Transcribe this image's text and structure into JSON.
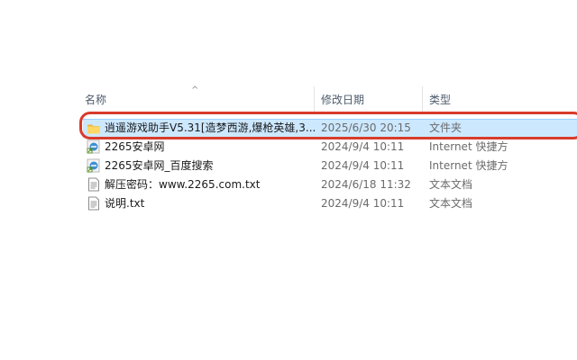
{
  "columns": {
    "name": "名称",
    "date": "修改日期",
    "type": "类型"
  },
  "sort_indicator": "^",
  "files": [
    {
      "icon": "folder-icon",
      "name": "逍遥游戏助手V5.31[造梦西游,爆枪英雄,3...",
      "date": "2025/6/30 20:15",
      "type": "文件夹",
      "selected": true
    },
    {
      "icon": "internet-shortcut-icon",
      "name": "2265安卓网",
      "date": "2024/9/4 10:11",
      "type": "Internet 快捷方",
      "selected": false
    },
    {
      "icon": "internet-shortcut-icon",
      "name": "2265安卓网_百度搜索",
      "date": "2024/9/4 10:11",
      "type": "Internet 快捷方",
      "selected": false
    },
    {
      "icon": "text-file-icon",
      "name": "解压密码：www.2265.com.txt",
      "date": "2024/6/18 11:32",
      "type": "文本文档",
      "selected": false
    },
    {
      "icon": "text-file-icon",
      "name": "说明.txt",
      "date": "2024/9/4 10:11",
      "type": "文本文档",
      "selected": false
    }
  ],
  "colors": {
    "selection_bg": "#cce8ff",
    "selection_border": "#99d1ff",
    "highlight_border": "#d83b2b",
    "folder_yellow": "#ffd766"
  }
}
